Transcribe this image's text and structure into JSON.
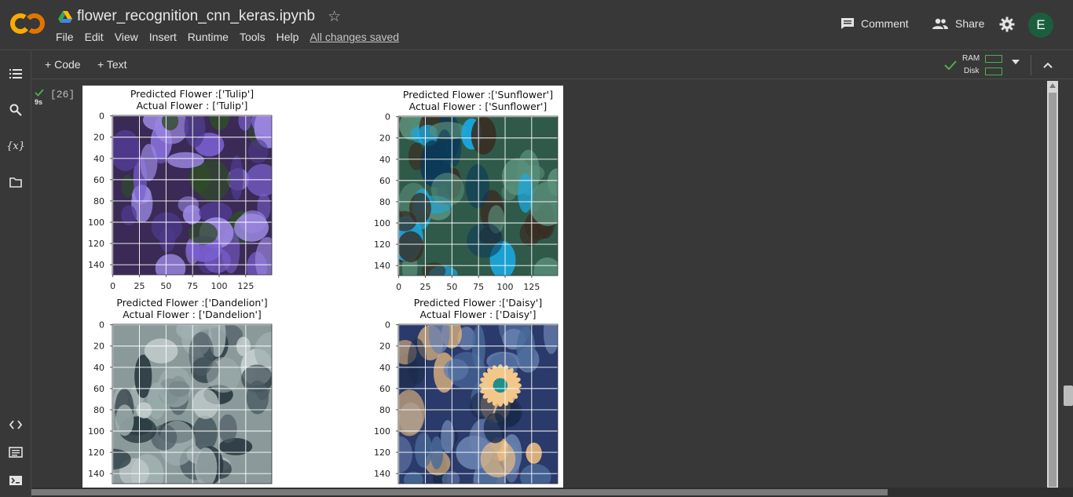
{
  "app": {
    "logo_text": "CO",
    "doc_title": "flower_recognition_cnn_keras.ipynb"
  },
  "menu": {
    "items": [
      "File",
      "Edit",
      "View",
      "Insert",
      "Runtime",
      "Tools",
      "Help"
    ],
    "saved_status": "All changes saved"
  },
  "header": {
    "comment_label": "Comment",
    "share_label": "Share",
    "avatar_initial": "E"
  },
  "toolbar": {
    "add_code_label": "Code",
    "add_text_label": "Text",
    "ram_label": "RAM",
    "disk_label": "Disk"
  },
  "cell": {
    "exec_count": "[26]",
    "run_time": "9s"
  },
  "icons": {
    "menu": "table-of-contents-icon",
    "search": "search-icon",
    "variables": "variables-icon",
    "files": "folder-icon",
    "snippets": "code-snippets-icon",
    "command_palette": "command-palette-icon",
    "terminal": "terminal-icon"
  },
  "colors": {
    "logo_orange": "#f9ab00",
    "logo_yellow": "#e37400",
    "success_green": "#4caf50",
    "avatar_bg": "#1b5e3e"
  },
  "plots": [
    {
      "title_line1": "Predicted Flower :['Tulip']",
      "title_line2": "Actual Flower : ['Tulip']",
      "yticks": [
        "0",
        "20",
        "40",
        "60",
        "80",
        "100",
        "120",
        "140"
      ],
      "xticks": [
        "0",
        "25",
        "50",
        "75",
        "100",
        "125"
      ],
      "image_palette": [
        "#3a2a55",
        "#7a5fd0",
        "#9a86e0",
        "#4f3a8f",
        "#2f4a2a"
      ]
    },
    {
      "title_line1": "Predicted Flower :['Sunflower']",
      "title_line2": "Actual Flower : ['Sunflower']",
      "yticks": [
        "0",
        "20",
        "40",
        "60",
        "80",
        "100",
        "120",
        "140"
      ],
      "xticks": [
        "0",
        "25",
        "50",
        "75",
        "100",
        "125"
      ],
      "image_palette": [
        "#2f5a4a",
        "#1aa9e0",
        "#0a3a5a",
        "#5a8f7a",
        "#3a2a20"
      ]
    },
    {
      "title_line1": "Predicted Flower :['Dandelion']",
      "title_line2": "Actual Flower : ['Dandelion']",
      "yticks": [
        "0",
        "20",
        "40",
        "60",
        "80",
        "100",
        "120",
        "140"
      ],
      "xticks": [],
      "image_palette": [
        "#8a9a9a",
        "#c8d0d0",
        "#4a5a62",
        "#a0b0b0",
        "#2a3a42"
      ]
    },
    {
      "title_line1": "Predicted Flower :['Daisy']",
      "title_line2": "Actual Flower : ['Daisy']",
      "yticks": [
        "0",
        "20",
        "40",
        "60",
        "80",
        "100",
        "120",
        "140"
      ],
      "xticks": [],
      "image_palette": [
        "#2a3a6a",
        "#6a82b0",
        "#1a2a4a",
        "#4a6a9a",
        "#f0c080"
      ]
    }
  ]
}
